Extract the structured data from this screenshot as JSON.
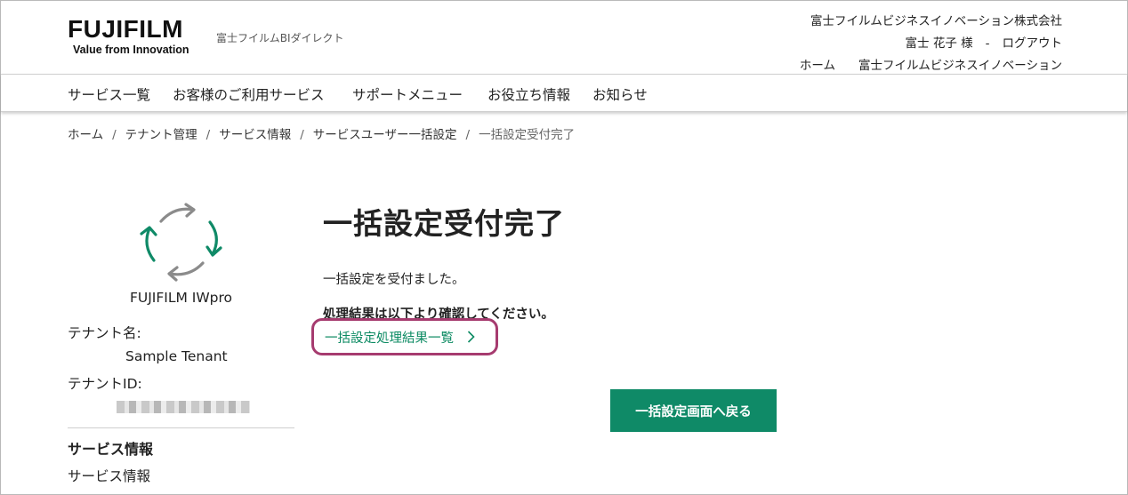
{
  "header": {
    "logo_text": "FUJIFILM",
    "logo_tagline": "Value from Innovation",
    "site_name": "富士フイルムBIダイレクト",
    "company_name": "富士フイルムビジネスイノベーション株式会社",
    "user_name": "富士 花子 様",
    "user_separator": "-",
    "logout_label": "ログアウト",
    "home_link": "ホーム",
    "corporate_link": "富士フイルムビジネスイノベーション"
  },
  "nav": {
    "items": [
      "サービス一覧",
      "お客様のご利用サービス",
      "サポートメニュー",
      "お役立ち情報",
      "お知らせ"
    ]
  },
  "breadcrumb": {
    "separator": "/",
    "items": [
      "ホーム",
      "テナント管理",
      "サービス情報",
      "サービスユーザー一括設定",
      "一括設定受付完了"
    ]
  },
  "sidebar": {
    "icon": "sync-arrows-icon",
    "product_name": "FUJIFILM IWpro",
    "tenant_name_label": "テナント名:",
    "tenant_name_value": "Sample Tenant",
    "tenant_id_label": "テナントID:",
    "section_title": "サービス情報",
    "section_item": "サービス情報"
  },
  "main": {
    "title": "一括設定受付完了",
    "message_1": "一括設定を受付ました。",
    "message_2": "処理結果は以下より確認してください。",
    "result_link": "一括設定処理結果一覧",
    "back_button": "一括設定画面へ戻る"
  },
  "colors": {
    "accent_green": "#0f8a67",
    "link_green": "#0b8a62",
    "highlight_border": "#a63b6f"
  }
}
